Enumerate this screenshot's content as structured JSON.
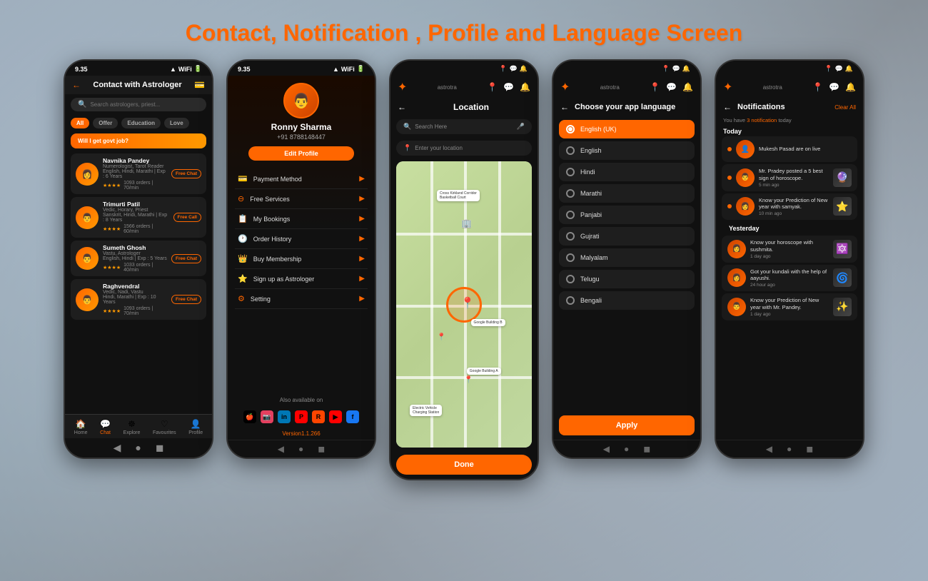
{
  "page": {
    "title": "Contact, Notification , Profile and Language Screen",
    "bg_note": "dark galaxy background"
  },
  "phone1": {
    "status_time": "9.35",
    "header_title": "Contact with Astrologer",
    "search_placeholder": "Search astrologers, priest...",
    "tabs": [
      "All",
      "Offer",
      "Education",
      "Love"
    ],
    "promo": "Will I get govt job?",
    "astrologers": [
      {
        "name": "Navnika Pandey",
        "spec": "Numerologist, Tarot Reader",
        "langs": "English, Hindi, Marathi",
        "exp": "Exp : 6 Years",
        "stars": "★★★★",
        "orders": "1093 orders",
        "min": "70/ min",
        "btn": "Free Chat"
      },
      {
        "name": "Trimurti Patil",
        "spec": "Vedic, Horary, Priest",
        "langs": "Sanskrit, Hindi, Marathi",
        "exp": "Exp : 8 Years",
        "stars": "★★★★",
        "orders": "1566 orders",
        "min": "60/ min",
        "btn": "Free Call"
      },
      {
        "name": "Sumeth Ghosh",
        "spec": "Vastu , Astrologer",
        "langs": "English, Hindi",
        "exp": "Exp : 5 Years",
        "stars": "★★★★",
        "orders": "1033 orders",
        "min": "40/ min",
        "btn": "Free Chat"
      },
      {
        "name": "Raghvendral",
        "spec": "Vedic, Nadi, Vastu",
        "langs": "Hindi, Marathi",
        "exp": "Exp : 10 Years",
        "stars": "★★★★",
        "orders": "1093 orders",
        "min": "70/ min",
        "btn": "Free Chat"
      }
    ],
    "nav_items": [
      "Home",
      "Chat",
      "Explore",
      "Favourites",
      "Profile"
    ]
  },
  "phone2": {
    "status_time": "9.35",
    "user_name": "Ronny Sharma",
    "user_phone": "+91 8788148447",
    "edit_btn": "Edit Profile",
    "menu_items": [
      "Payment Method",
      "Free Services",
      "My Bookings",
      "Order History",
      "Buy Membership",
      "Sign up as Astrologer",
      "Setting"
    ],
    "also_label": "Also available on",
    "version": "Version1.1.266"
  },
  "phone3": {
    "header_title": "Location",
    "search_placeholder": "Search Here",
    "location_placeholder": "Enter your location",
    "map_labels": [
      "Cross Kirkland Corridor Basketball Court",
      "Google Building B",
      "Google Building A",
      "Electric Vehicle Charging Station"
    ],
    "done_btn": "Done"
  },
  "phone4": {
    "header_title": "Choose your app language",
    "languages": [
      {
        "name": "English (UK)",
        "active": true
      },
      {
        "name": "English",
        "active": false
      },
      {
        "name": "Hindi",
        "active": false
      },
      {
        "name": "Marathi",
        "active": false
      },
      {
        "name": "Panjabi",
        "active": false
      },
      {
        "name": "Gujrati",
        "active": false
      },
      {
        "name": "Malyalam",
        "active": false
      },
      {
        "name": "Telugu",
        "active": false
      },
      {
        "name": "Bengali",
        "active": false
      }
    ],
    "apply_btn": "Apply"
  },
  "phone5": {
    "header_title": "Notifications",
    "clear_all": "Clear All",
    "sub_text": "You have",
    "notif_count": "3 notification",
    "notif_suffix": "today",
    "today_label": "Today",
    "yesterday_label": "Yesterday",
    "notifications": [
      {
        "text": "Mukesh Pasad are on live",
        "time": "",
        "section": "today"
      },
      {
        "text": "Mr. Pradey posted a 5 best sign of horoscope.",
        "time": "5 min ago",
        "section": "today"
      },
      {
        "text": "Know your Prediction of New year with samyak.",
        "time": "10 min ago",
        "section": "today"
      },
      {
        "text": "Know your horoscope with sushmita.",
        "time": "1 day ago",
        "section": "yesterday"
      },
      {
        "text": "Got your kundali with the help of aayushi.",
        "time": "24 hour ago",
        "section": "yesterday"
      },
      {
        "text": "Know your Prediction of New year with Mr. Pandey.",
        "time": "1 day ago",
        "section": "yesterday"
      }
    ]
  }
}
